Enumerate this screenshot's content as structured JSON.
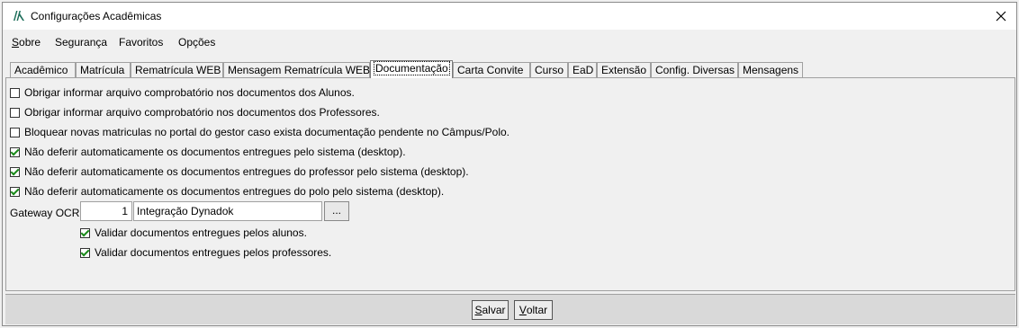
{
  "window": {
    "title": "Configurações Acadêmicas"
  },
  "menu": [
    {
      "label": "Sobre"
    },
    {
      "label": "Segurança"
    },
    {
      "label": "Favoritos"
    },
    {
      "label": "Opções"
    }
  ],
  "tabs": [
    {
      "label": "Acadêmico"
    },
    {
      "label": "Matrícula"
    },
    {
      "label": "Rematrícula WEB"
    },
    {
      "label": "Mensagem Rematrícula WEB"
    },
    {
      "label": "Documentação",
      "active": true
    },
    {
      "label": "Carta Convite"
    },
    {
      "label": "Curso"
    },
    {
      "label": "EaD"
    },
    {
      "label": "Extensão"
    },
    {
      "label": "Config. Diversas"
    },
    {
      "label": "Mensagens"
    }
  ],
  "options": [
    {
      "label": "Obrigar informar arquivo comprobatório nos documentos dos Alunos.",
      "checked": false
    },
    {
      "label": "Obrigar informar arquivo comprobatório nos documentos dos Professores.",
      "checked": false
    },
    {
      "label": "Bloquear novas matriculas no portal do gestor caso exista documentação pendente no Câmpus/Polo.",
      "checked": false
    },
    {
      "label": "Não deferir automaticamente os documentos entregues pelo sistema (desktop).",
      "checked": true
    },
    {
      "label": "Não deferir automaticamente os documentos entregues do professor pelo sistema (desktop).",
      "checked": true
    },
    {
      "label": "Não deferir automaticamente os documentos entregues do polo pelo sistema (desktop).",
      "checked": true
    }
  ],
  "gateway": {
    "label": "Gateway OCR:",
    "code": "1",
    "name": "Integração Dynadok",
    "browse_label": "..."
  },
  "validations": [
    {
      "label": "Validar documentos entregues pelos alunos.",
      "checked": true
    },
    {
      "label": "Validar documentos entregues pelos professores.",
      "checked": true
    }
  ],
  "buttons": {
    "save_rest": "alvar",
    "save_key": "S",
    "back_rest": "oltar",
    "back_key": "V"
  },
  "menu_keys": {
    "sobre_key": "S",
    "sobre_rest": "obre"
  }
}
